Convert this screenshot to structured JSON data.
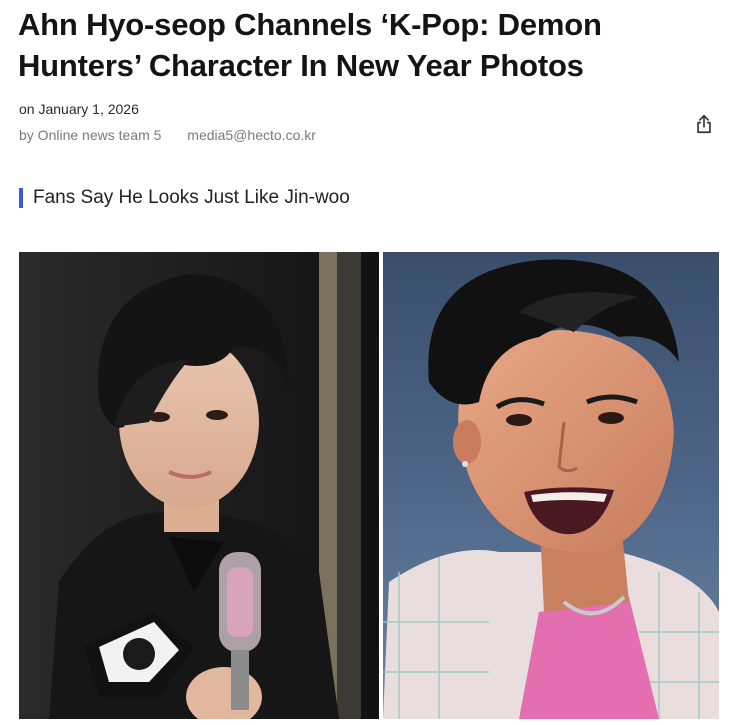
{
  "article": {
    "headline": "Ahn Hyo-seop Channels ‘K-Pop: Demon Hunters’ Character In New Year Photos",
    "date": "on January 1, 2026",
    "author": "by Online news team 5",
    "email": "media5@hecto.co.kr",
    "subheading": "Fans Say He Looks Just Like Jin-woo"
  },
  "icons": {
    "share": "share-icon"
  },
  "colors": {
    "accent_bar": "#3d5bd9",
    "headline": "#141414",
    "meta": "#7a7a7a"
  }
}
